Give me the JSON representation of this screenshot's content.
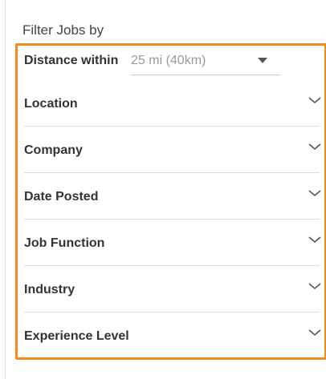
{
  "filter_panel": {
    "title": "Filter Jobs by",
    "distance": {
      "label": "Distance within",
      "selected": "25 mi (40km)"
    },
    "facets": [
      {
        "label": "Location",
        "icon": "chevron-down-icon"
      },
      {
        "label": "Company",
        "icon": "chevron-down-icon"
      },
      {
        "label": "Date Posted",
        "icon": "chevron-down-icon"
      },
      {
        "label": "Job Function",
        "icon": "chevron-down-icon"
      },
      {
        "label": "Industry",
        "icon": "chevron-down-icon"
      },
      {
        "label": "Experience Level",
        "icon": "chevron-down-icon"
      }
    ],
    "colors": {
      "highlight_border": "#f58a1f",
      "label_text": "#333333",
      "placeholder_text": "#999999"
    }
  }
}
